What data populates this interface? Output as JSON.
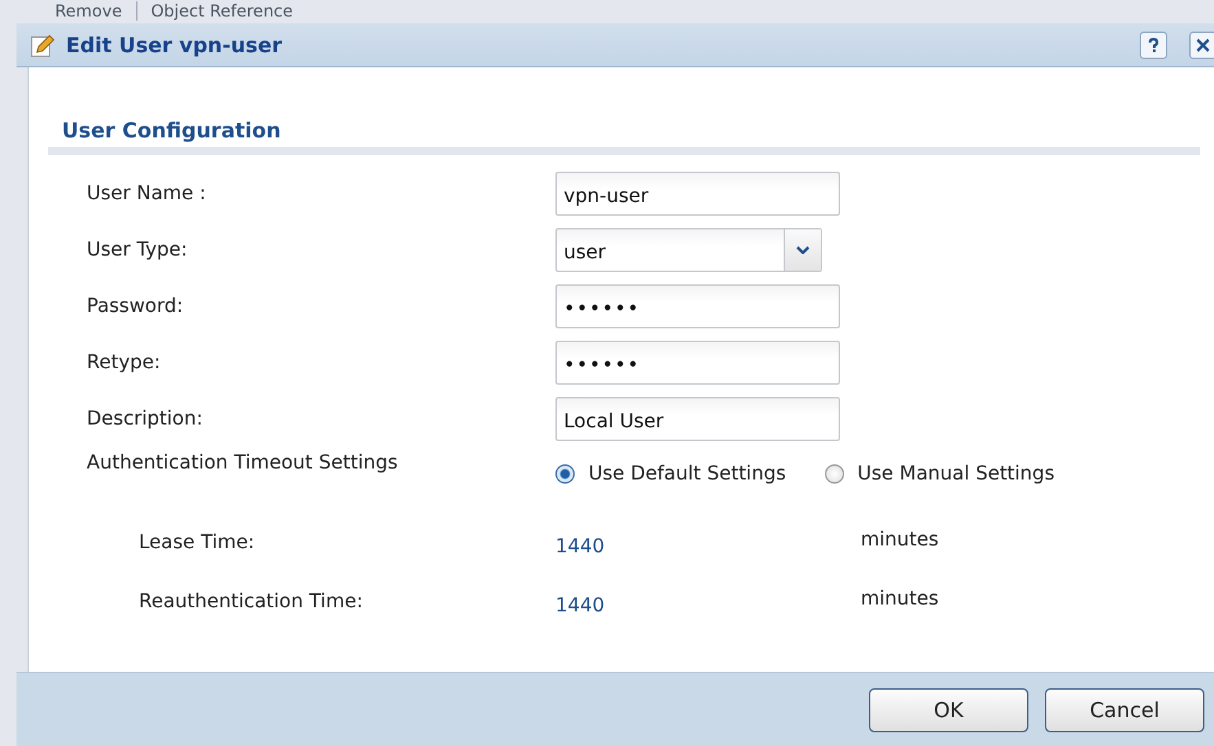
{
  "background_toolbar": {
    "items": [
      "Remove",
      "Object Reference"
    ]
  },
  "window": {
    "title": "Edit User vpn-user"
  },
  "section": {
    "title": "User Configuration"
  },
  "fields": [
    {
      "kind": "text",
      "label": "User Name :",
      "value": "vpn-user"
    },
    {
      "kind": "select",
      "label": "User Type:",
      "value": "user"
    },
    {
      "kind": "password",
      "label": "Password:",
      "value": "••••••"
    },
    {
      "kind": "password",
      "label": "Retype:",
      "value": "••••••"
    },
    {
      "kind": "text",
      "label": "Description:",
      "value": "Local User"
    }
  ],
  "timeout": {
    "label": "Authentication Timeout Settings",
    "options": [
      {
        "label": "Use Default Settings",
        "selected": true
      },
      {
        "label": "Use Manual Settings",
        "selected": false
      }
    ]
  },
  "times": [
    {
      "label": "Lease Time:",
      "value": "1440",
      "unit": "minutes"
    },
    {
      "label": "Reauthentication Time:",
      "value": "1440",
      "unit": "minutes"
    }
  ],
  "buttons": [
    "OK",
    "Cancel"
  ]
}
